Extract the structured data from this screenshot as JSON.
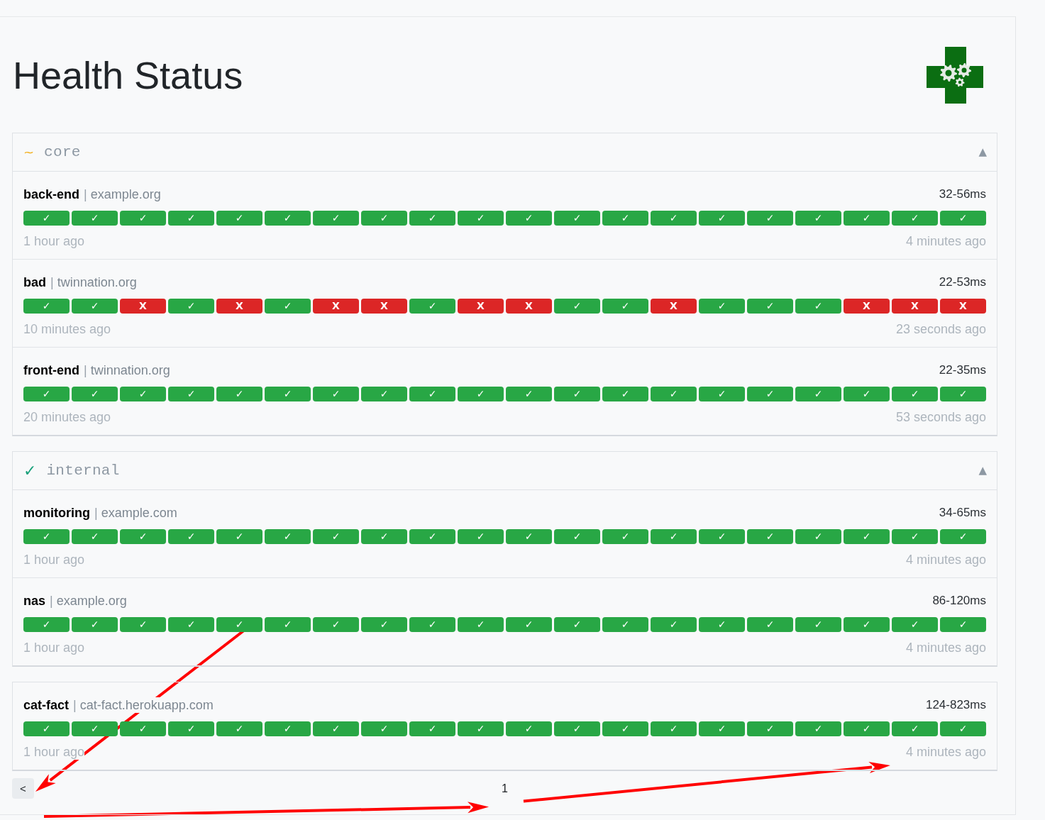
{
  "title": "Health Status",
  "groups": [
    {
      "name": "core",
      "icon": {
        "text": "~",
        "color": "#f2b01e"
      },
      "toggle": "▲",
      "expanded": true,
      "services": [
        {
          "name": "back-end",
          "separator": "|",
          "domain": "example.org",
          "response_time": "32-56ms",
          "oldest": "1 hour ago",
          "newest": "4 minutes ago",
          "checks": [
            {
              "mark": "✓",
              "passed": true
            },
            {
              "mark": "✓",
              "passed": true
            },
            {
              "mark": "✓",
              "passed": true
            },
            {
              "mark": "✓",
              "passed": true
            },
            {
              "mark": "✓",
              "passed": true
            },
            {
              "mark": "✓",
              "passed": true
            },
            {
              "mark": "✓",
              "passed": true
            },
            {
              "mark": "✓",
              "passed": true
            },
            {
              "mark": "✓",
              "passed": true
            },
            {
              "mark": "✓",
              "passed": true
            },
            {
              "mark": "✓",
              "passed": true
            },
            {
              "mark": "✓",
              "passed": true
            },
            {
              "mark": "✓",
              "passed": true
            },
            {
              "mark": "✓",
              "passed": true
            },
            {
              "mark": "✓",
              "passed": true
            },
            {
              "mark": "✓",
              "passed": true
            },
            {
              "mark": "✓",
              "passed": true
            },
            {
              "mark": "✓",
              "passed": true
            },
            {
              "mark": "✓",
              "passed": true
            },
            {
              "mark": "✓",
              "passed": true
            }
          ]
        },
        {
          "name": "bad",
          "separator": "|",
          "domain": "twinnation.org",
          "response_time": "22-53ms",
          "oldest": "10 minutes ago",
          "newest": "23 seconds ago",
          "checks": [
            {
              "mark": "✓",
              "passed": true
            },
            {
              "mark": "✓",
              "passed": true
            },
            {
              "mark": "X",
              "passed": false
            },
            {
              "mark": "✓",
              "passed": true
            },
            {
              "mark": "X",
              "passed": false
            },
            {
              "mark": "✓",
              "passed": true
            },
            {
              "mark": "X",
              "passed": false
            },
            {
              "mark": "X",
              "passed": false
            },
            {
              "mark": "✓",
              "passed": true
            },
            {
              "mark": "X",
              "passed": false
            },
            {
              "mark": "X",
              "passed": false
            },
            {
              "mark": "✓",
              "passed": true
            },
            {
              "mark": "✓",
              "passed": true
            },
            {
              "mark": "X",
              "passed": false
            },
            {
              "mark": "✓",
              "passed": true
            },
            {
              "mark": "✓",
              "passed": true
            },
            {
              "mark": "✓",
              "passed": true
            },
            {
              "mark": "X",
              "passed": false
            },
            {
              "mark": "X",
              "passed": false
            },
            {
              "mark": "X",
              "passed": false
            }
          ]
        },
        {
          "name": "front-end",
          "separator": "|",
          "domain": "twinnation.org",
          "response_time": "22-35ms",
          "oldest": "20 minutes ago",
          "newest": "53 seconds ago",
          "checks": [
            {
              "mark": "✓",
              "passed": true
            },
            {
              "mark": "✓",
              "passed": true
            },
            {
              "mark": "✓",
              "passed": true
            },
            {
              "mark": "✓",
              "passed": true
            },
            {
              "mark": "✓",
              "passed": true
            },
            {
              "mark": "✓",
              "passed": true
            },
            {
              "mark": "✓",
              "passed": true
            },
            {
              "mark": "✓",
              "passed": true
            },
            {
              "mark": "✓",
              "passed": true
            },
            {
              "mark": "✓",
              "passed": true
            },
            {
              "mark": "✓",
              "passed": true
            },
            {
              "mark": "✓",
              "passed": true
            },
            {
              "mark": "✓",
              "passed": true
            },
            {
              "mark": "✓",
              "passed": true
            },
            {
              "mark": "✓",
              "passed": true
            },
            {
              "mark": "✓",
              "passed": true
            },
            {
              "mark": "✓",
              "passed": true
            },
            {
              "mark": "✓",
              "passed": true
            },
            {
              "mark": "✓",
              "passed": true
            },
            {
              "mark": "✓",
              "passed": true
            }
          ]
        }
      ]
    },
    {
      "name": "internal",
      "icon": {
        "text": "✓",
        "color": "#17a07a"
      },
      "toggle": "▲",
      "expanded": true,
      "services": [
        {
          "name": "monitoring",
          "separator": "|",
          "domain": "example.com",
          "response_time": "34-65ms",
          "oldest": "1 hour ago",
          "newest": "4 minutes ago",
          "checks": [
            {
              "mark": "✓",
              "passed": true
            },
            {
              "mark": "✓",
              "passed": true
            },
            {
              "mark": "✓",
              "passed": true
            },
            {
              "mark": "✓",
              "passed": true
            },
            {
              "mark": "✓",
              "passed": true
            },
            {
              "mark": "✓",
              "passed": true
            },
            {
              "mark": "✓",
              "passed": true
            },
            {
              "mark": "✓",
              "passed": true
            },
            {
              "mark": "✓",
              "passed": true
            },
            {
              "mark": "✓",
              "passed": true
            },
            {
              "mark": "✓",
              "passed": true
            },
            {
              "mark": "✓",
              "passed": true
            },
            {
              "mark": "✓",
              "passed": true
            },
            {
              "mark": "✓",
              "passed": true
            },
            {
              "mark": "✓",
              "passed": true
            },
            {
              "mark": "✓",
              "passed": true
            },
            {
              "mark": "✓",
              "passed": true
            },
            {
              "mark": "✓",
              "passed": true
            },
            {
              "mark": "✓",
              "passed": true
            },
            {
              "mark": "✓",
              "passed": true
            }
          ]
        },
        {
          "name": "nas",
          "separator": "|",
          "domain": "example.org",
          "response_time": "86-120ms",
          "oldest": "1 hour ago",
          "newest": "4 minutes ago",
          "checks": [
            {
              "mark": "✓",
              "passed": true
            },
            {
              "mark": "✓",
              "passed": true
            },
            {
              "mark": "✓",
              "passed": true
            },
            {
              "mark": "✓",
              "passed": true
            },
            {
              "mark": "✓",
              "passed": true
            },
            {
              "mark": "✓",
              "passed": true
            },
            {
              "mark": "✓",
              "passed": true
            },
            {
              "mark": "✓",
              "passed": true
            },
            {
              "mark": "✓",
              "passed": true
            },
            {
              "mark": "✓",
              "passed": true
            },
            {
              "mark": "✓",
              "passed": true
            },
            {
              "mark": "✓",
              "passed": true
            },
            {
              "mark": "✓",
              "passed": true
            },
            {
              "mark": "✓",
              "passed": true
            },
            {
              "mark": "✓",
              "passed": true
            },
            {
              "mark": "✓",
              "passed": true
            },
            {
              "mark": "✓",
              "passed": true
            },
            {
              "mark": "✓",
              "passed": true
            },
            {
              "mark": "✓",
              "passed": true
            },
            {
              "mark": "✓",
              "passed": true
            }
          ]
        }
      ]
    },
    {
      "services": [
        {
          "name": "cat-fact",
          "separator": "|",
          "domain": "cat-fact.herokuapp.com",
          "response_time": "124-823ms",
          "oldest": "1 hour ago",
          "newest": "4 minutes ago",
          "checks": [
            {
              "mark": "✓",
              "passed": true
            },
            {
              "mark": "✓",
              "passed": true
            },
            {
              "mark": "✓",
              "passed": true
            },
            {
              "mark": "✓",
              "passed": true
            },
            {
              "mark": "✓",
              "passed": true
            },
            {
              "mark": "✓",
              "passed": true
            },
            {
              "mark": "✓",
              "passed": true
            },
            {
              "mark": "✓",
              "passed": true
            },
            {
              "mark": "✓",
              "passed": true
            },
            {
              "mark": "✓",
              "passed": true
            },
            {
              "mark": "✓",
              "passed": true
            },
            {
              "mark": "✓",
              "passed": true
            },
            {
              "mark": "✓",
              "passed": true
            },
            {
              "mark": "✓",
              "passed": true
            },
            {
              "mark": "✓",
              "passed": true
            },
            {
              "mark": "✓",
              "passed": true
            },
            {
              "mark": "✓",
              "passed": true
            },
            {
              "mark": "✓",
              "passed": true
            },
            {
              "mark": "✓",
              "passed": true
            },
            {
              "mark": "✓",
              "passed": true
            }
          ]
        }
      ]
    }
  ],
  "pagination": {
    "previous": "<",
    "page": "1"
  }
}
